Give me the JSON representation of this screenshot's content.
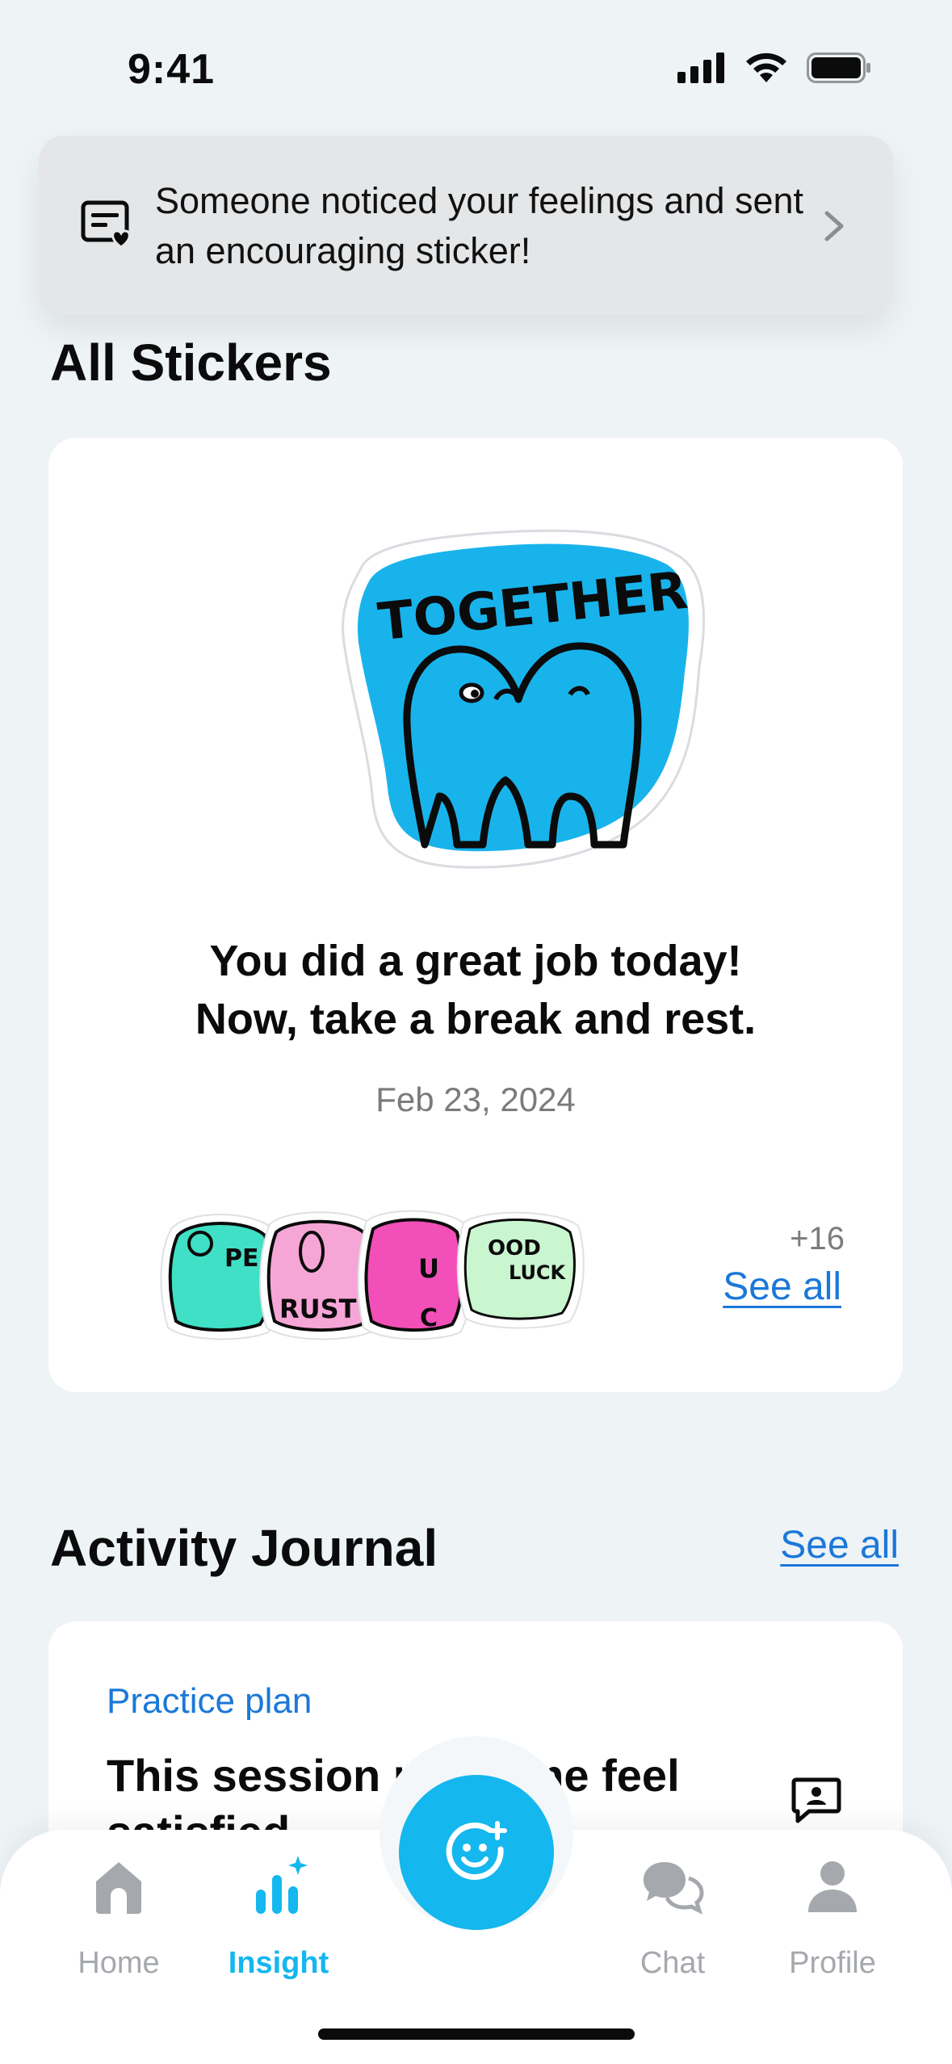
{
  "status_bar": {
    "time": "9:41"
  },
  "notification": {
    "icon": "sticker-message-icon",
    "text": "Someone noticed your feelings and sent an encouraging sticker!"
  },
  "stickers": {
    "title": "All Stickers",
    "featured_sticker": {
      "label": "TOGETHER"
    },
    "message_line1": "You did a great job today!",
    "message_line2": "Now, take a break and rest.",
    "date": "Feb 23, 2024",
    "mini_stickers": [
      {
        "label": "PEACE",
        "color": "#3FE0C5"
      },
      {
        "label": "TRUST",
        "color": "#F6A6D6"
      },
      {
        "label": "MUSIC",
        "color": "#F24FB8"
      },
      {
        "label": "GOOD LUCK",
        "color": "#C9F6CF"
      }
    ],
    "more_count": "+16",
    "see_all": "See all"
  },
  "journal": {
    "title": "Activity Journal",
    "see_all": "See all",
    "tag": "Practice plan",
    "entry_text": "This session made me feel satisfied",
    "icon": "comment-icon"
  },
  "tabbar": {
    "tabs": [
      {
        "label": "Home",
        "icon": "home-icon",
        "active": false
      },
      {
        "label": "Insight",
        "icon": "insight-chart-icon",
        "active": true
      },
      {
        "label": "Chat",
        "icon": "chat-icon",
        "active": false
      },
      {
        "label": "Profile",
        "icon": "profile-icon",
        "active": false
      }
    ],
    "fab_icon": "add-mood-icon"
  },
  "colors": {
    "accent": "#14B7EE",
    "link": "#1B78D8",
    "background": "#EEF3F6"
  }
}
